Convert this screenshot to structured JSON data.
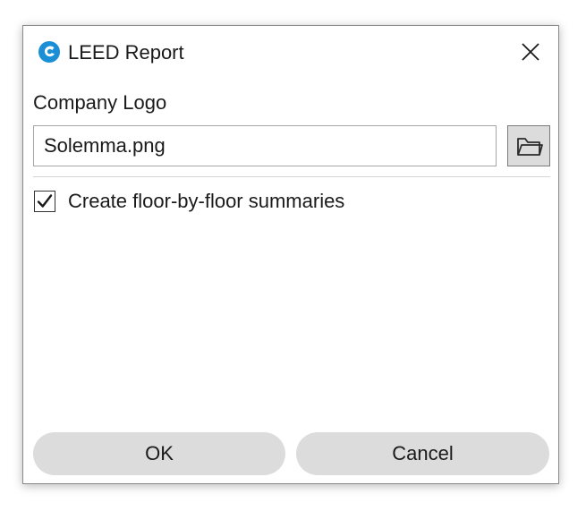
{
  "window": {
    "title": "LEED Report",
    "icon": "solemma-logo-icon",
    "close_icon": "close-icon"
  },
  "company_logo": {
    "label": "Company Logo",
    "value": "Solemma.png",
    "browse_icon": "folder-icon"
  },
  "options": {
    "floor_summaries": {
      "label": "Create floor-by-floor summaries",
      "checked": true
    }
  },
  "buttons": {
    "ok_label": "OK",
    "cancel_label": "Cancel"
  },
  "colors": {
    "button_bg": "#dcdcdc",
    "logo_blue": "#1a8fd6"
  }
}
